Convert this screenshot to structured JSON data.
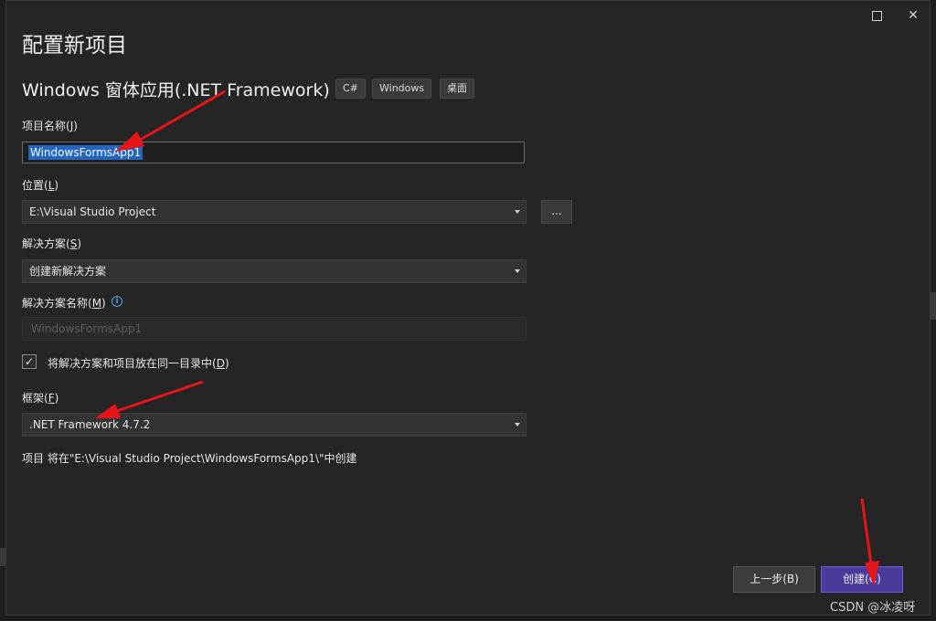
{
  "dialog": {
    "heading": "配置新项目",
    "template_name": "Windows 窗体应用(.NET Framework)",
    "tags": [
      "C#",
      "Windows",
      "桌面"
    ]
  },
  "titlebar": {
    "maximize_icon": "maximize-icon",
    "close_icon": "close-icon"
  },
  "project_name": {
    "label": "项目名称(",
    "label_key": "J",
    "label_end": ")",
    "value": "WindowsFormsApp1"
  },
  "location": {
    "label": "位置(",
    "label_key": "L",
    "label_end": ")",
    "value": "E:\\Visual Studio Project",
    "browse_label": "..."
  },
  "solution": {
    "label": "解决方案(",
    "label_key": "S",
    "label_end": ")",
    "value": "创建新解决方案"
  },
  "solution_name": {
    "label": "解决方案名称(",
    "label_key": "M",
    "label_end": ")",
    "placeholder": "WindowsFormsApp1",
    "info_icon": "info-icon"
  },
  "same_directory": {
    "label": "将解决方案和项目放在同一目录中(",
    "label_key": "D",
    "label_end": ")",
    "checked": true
  },
  "framework": {
    "label": "框架(",
    "label_key": "F",
    "label_end": ")",
    "value": ".NET Framework 4.7.2"
  },
  "summary": "项目 将在\"E:\\Visual Studio Project\\WindowsFormsApp1\\\"中创建",
  "buttons": {
    "back": "上一步(B)",
    "create": "创建(C)"
  },
  "watermark": "CSDN @冰凌呀",
  "colors": {
    "accent": "#4b3a99",
    "selection": "#2266c4",
    "arrow": "#e8141a"
  }
}
